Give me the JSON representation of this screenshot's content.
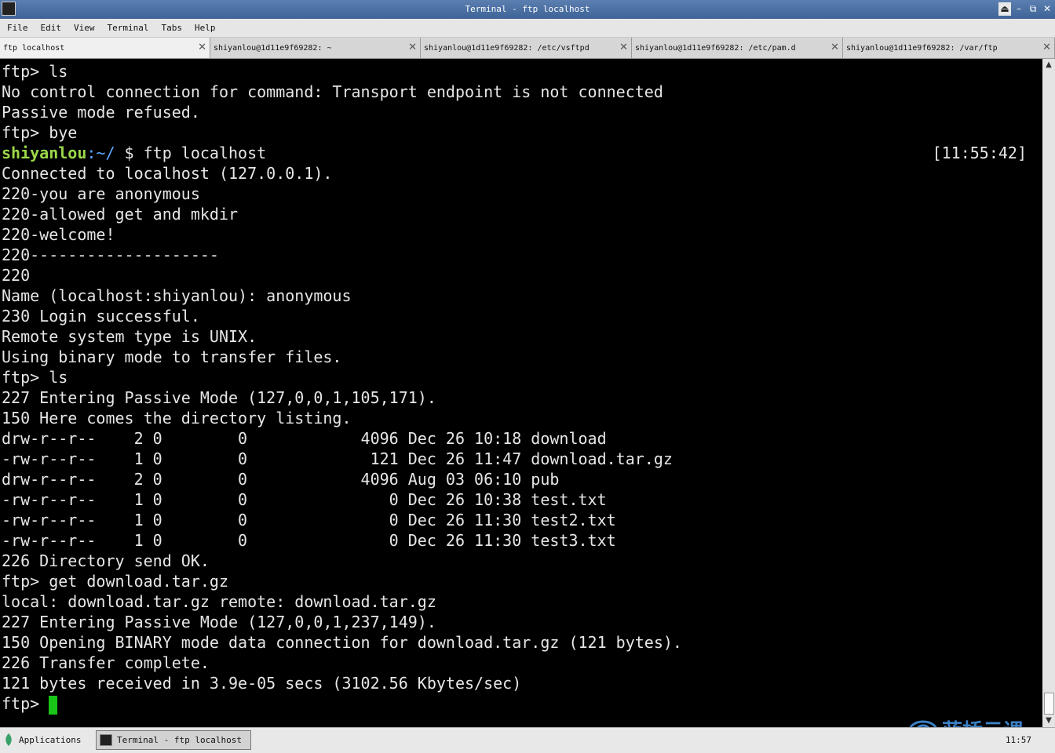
{
  "window": {
    "title": "Terminal - ftp localhost"
  },
  "menu": [
    "File",
    "Edit",
    "View",
    "Terminal",
    "Tabs",
    "Help"
  ],
  "tabs": [
    {
      "label": "ftp localhost",
      "active": true
    },
    {
      "label": "shiyanlou@1d11e9f69282: ~",
      "active": false
    },
    {
      "label": "shiyanlou@1d11e9f69282: /etc/vsftpd",
      "active": false
    },
    {
      "label": "shiyanlou@1d11e9f69282: /etc/pam.d",
      "active": false
    },
    {
      "label": "shiyanlou@1d11e9f69282: /var/ftp",
      "active": false
    }
  ],
  "terminal": {
    "prompt_user": "shiyanlou",
    "prompt_sep": ":",
    "prompt_path": "~/",
    "prompt_rest": " $ ftp localhost",
    "timestamp": "[11:55:42]",
    "lines_before": [
      "ftp> ls",
      "No control connection for command: Transport endpoint is not connected",
      "Passive mode refused.",
      "ftp> bye"
    ],
    "lines_after": [
      "Connected to localhost (127.0.0.1).",
      "220-you are anonymous",
      "220-allowed get and mkdir",
      "220-welcome!",
      "220--------------------",
      "220",
      "Name (localhost:shiyanlou): anonymous",
      "230 Login successful.",
      "Remote system type is UNIX.",
      "Using binary mode to transfer files.",
      "ftp> ls",
      "227 Entering Passive Mode (127,0,0,1,105,171).",
      "150 Here comes the directory listing.",
      "drw-r--r--    2 0        0            4096 Dec 26 10:18 download",
      "-rw-r--r--    1 0        0             121 Dec 26 11:47 download.tar.gz",
      "drw-r--r--    2 0        0            4096 Aug 03 06:10 pub",
      "-rw-r--r--    1 0        0               0 Dec 26 10:38 test.txt",
      "-rw-r--r--    1 0        0               0 Dec 26 11:30 test2.txt",
      "-rw-r--r--    1 0        0               0 Dec 26 11:30 test3.txt",
      "226 Directory send OK.",
      "ftp> get download.tar.gz",
      "local: download.tar.gz remote: download.tar.gz",
      "227 Entering Passive Mode (127,0,0,1,237,149).",
      "150 Opening BINARY mode data connection for download.tar.gz (121 bytes).",
      "226 Transfer complete.",
      "121 bytes received in 3.9e-05 secs (3102.56 Kbytes/sec)"
    ],
    "final_prompt": "ftp> "
  },
  "taskbar": {
    "applications_label": "Applications",
    "task_label": "Terminal - ftp localhost",
    "clock": "11:57"
  },
  "watermark": {
    "text": "蓝桥云课"
  },
  "colors": {
    "prompt_user": "#9bd84a",
    "prompt_path": "#5aa8ff",
    "cursor": "#19c419"
  }
}
